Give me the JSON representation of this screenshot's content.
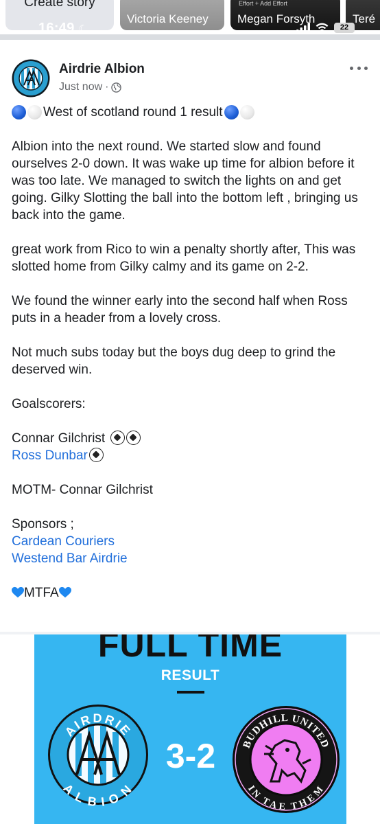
{
  "status_bar": {
    "time": "16:49",
    "battery": "22"
  },
  "stories": [
    {
      "label": "Create story"
    },
    {
      "label": "Victoria Keeney"
    },
    {
      "label": "Megan Forsyth",
      "preview_text": "Effort + Add Effort"
    },
    {
      "label": "Teré"
    }
  ],
  "post": {
    "page_name": "Airdrie Albion",
    "timestamp": "Just now",
    "title": "West of scotland round 1 result",
    "paragraphs": [
      "Albion into the next round. We started slow and found ourselves 2-0 down. It was wake up time for albion before it was too late. We managed to switch the lights on and get going. Gilky Slotting the ball into the bottom left , bringing us back into the game.",
      "great work from Rico to win a penalty shortly after, This was slotted home from Gilky calmy and its game on 2-2.",
      "We found the winner  early into the second half when Ross puts in a header from a lovely cross.",
      "Not much subs today but the boys dug deep to grind the deserved win."
    ],
    "goalscorers_heading": "Goalscorers:",
    "scorers": [
      {
        "name": "Connar Gilchrist",
        "goals": 2,
        "is_link": false
      },
      {
        "name": "Ross Dunbar",
        "goals": 1,
        "is_link": true
      }
    ],
    "motm": "MOTM- Connar Gilchrist",
    "sponsors_heading": "Sponsors ;",
    "sponsors": [
      "Cardean Couriers",
      "Westend Bar Airdrie"
    ],
    "signoff": "MTFA"
  },
  "result_graphic": {
    "headline": "FULL TIME",
    "subheading": "RESULT",
    "score": "3-2",
    "home_crest_text": {
      "top": "AIRDRIE",
      "bottom": "ALBION"
    },
    "away_crest_text": {
      "top": "BUDHILL UNITED",
      "bottom": "IN TAE THEM"
    },
    "background_color": "#36b6f1"
  },
  "colors": {
    "link": "#216fdb",
    "muted": "#65676b",
    "text": "#1c1e21"
  }
}
